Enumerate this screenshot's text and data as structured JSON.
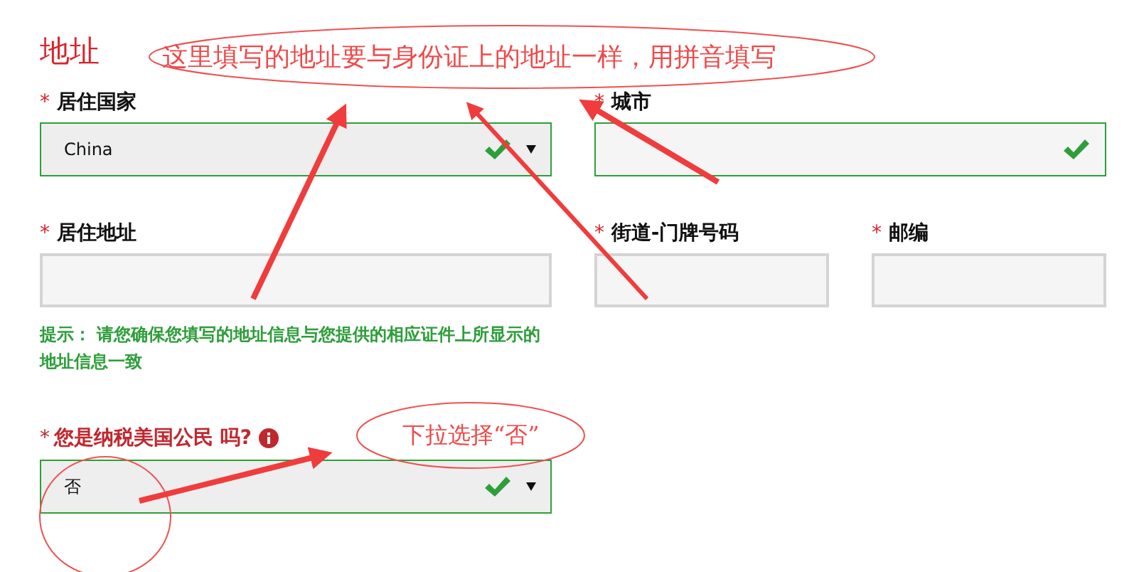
{
  "title": "地址",
  "rows": [
    [
      {
        "kind": "select",
        "mark": "*",
        "label": "居住国家",
        "value": "China",
        "valid": true
      },
      {
        "kind": "text",
        "mark": "*",
        "label": "城市",
        "valid": true
      }
    ],
    [
      {
        "kind": "text",
        "mark": "*",
        "label": "居住地址",
        "valid": false
      },
      {
        "kind": "text",
        "mark": "*",
        "label": "街道-门牌号码",
        "valid": false
      },
      {
        "kind": "text",
        "mark": "*",
        "label": "邮编",
        "valid": false
      }
    ]
  ],
  "hint": "提示： 请您确保您填写的地址信息与您提供的相应证件上所显示的地址信息一致",
  "question": {
    "kind": "select",
    "mark": "*",
    "label": "您是纳税美国公民 吗?",
    "value": "否",
    "valid": true,
    "info": true
  },
  "annotations": [
    {
      "text": "这里填写的地址要与身份证上的地址一样，用拼音填写"
    },
    {
      "text": "下拉选择“否”"
    }
  ]
}
